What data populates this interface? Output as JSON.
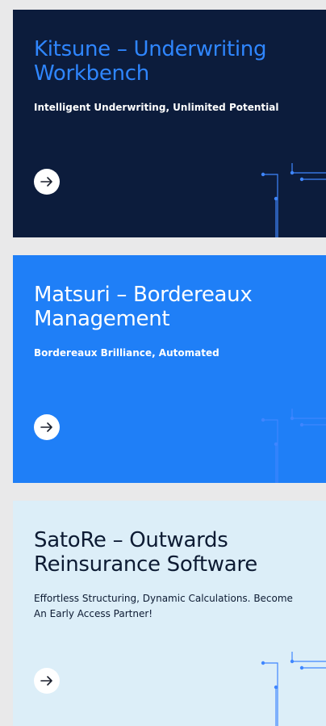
{
  "colors": {
    "page_bg": "#e9e9ea",
    "card1_bg": "#0c1c3c",
    "card1_title": "#2f86ff",
    "card1_text": "#ffffff",
    "card2_bg": "#1f7ff7",
    "card2_text": "#ffffff",
    "card3_bg": "#dceef8",
    "card3_text": "#0d1b33",
    "arrow_stroke": "#1a1f2c",
    "circuit_line": "#3f86ff"
  },
  "cards": [
    {
      "title": "Kitsune – Underwriting Workbench",
      "subtitle": "Intelligent Underwriting, Unlimited Potential",
      "arrow_icon": "arrow-right-icon"
    },
    {
      "title": "Matsuri – Bordereaux Management",
      "subtitle": "Bordereaux Brilliance, Automated",
      "arrow_icon": "arrow-right-icon"
    },
    {
      "title": "SatoRe – Outwards Reinsurance Software",
      "subtitle": "Effortless Structuring, Dynamic Calculations. Become An Early Access Partner!",
      "arrow_icon": "arrow-right-icon"
    }
  ]
}
